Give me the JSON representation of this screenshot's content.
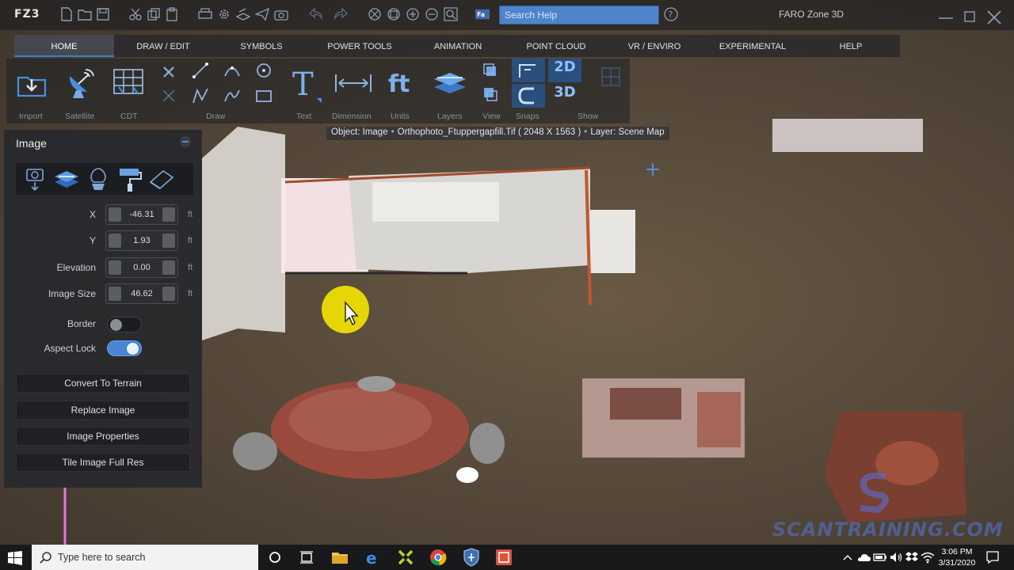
{
  "app": {
    "logo": "FZ3",
    "title": "FARO Zone 3D",
    "search_placeholder": "Search Help"
  },
  "tabs": [
    {
      "label": "HOME"
    },
    {
      "label": "DRAW / EDIT"
    },
    {
      "label": "SYMBOLS"
    },
    {
      "label": "POWER TOOLS"
    },
    {
      "label": "ANIMATION"
    },
    {
      "label": "POINT CLOUD"
    },
    {
      "label": "VR / ENVIRO"
    },
    {
      "label": "EXPERIMENTAL"
    },
    {
      "label": "HELP"
    }
  ],
  "ribbon_groups": {
    "import": "Import",
    "satellite": "Satellite",
    "cdt": "CDT",
    "draw": "Draw",
    "text": "Text",
    "dimension": "Dimension",
    "units": "Units",
    "layers": "Layers",
    "view": "View",
    "snaps": "Snaps",
    "show": "Show"
  },
  "ribbon_buttons": {
    "view_2d": "2D",
    "view_3d": "3D"
  },
  "object_info": {
    "object": "Object: Image",
    "file": "Orthophoto_Ftuppergapfill.Tif",
    "dims": "( 2048 X 1563 )",
    "layer": "Layer: Scene Map"
  },
  "panel": {
    "title": "Image",
    "fields": [
      {
        "label": "X",
        "value": "-46.31",
        "unit": "ft"
      },
      {
        "label": "Y",
        "value": "1.93",
        "unit": "ft"
      },
      {
        "label": "Elevation",
        "value": "0.00",
        "unit": "ft"
      },
      {
        "label": "Image Size",
        "value": "46.62",
        "unit": "ft"
      }
    ],
    "border_label": "Border",
    "border_on": false,
    "aspect_label": "Aspect Lock",
    "aspect_on": true,
    "buttons": [
      {
        "label": "Convert To Terrain"
      },
      {
        "label": "Replace Image"
      },
      {
        "label": "Image Properties"
      },
      {
        "label": "Tile Image Full Res"
      }
    ]
  },
  "watermark": {
    "text": "SCANTRAINING.COM"
  },
  "taskbar": {
    "search_placeholder": "Type here to search",
    "time": "3:06 PM",
    "date": "3/31/2020"
  },
  "colors": {
    "accent": "#3b7ed1",
    "search_bg": "#4e84c9",
    "toggle_on": "#4a86d4"
  }
}
